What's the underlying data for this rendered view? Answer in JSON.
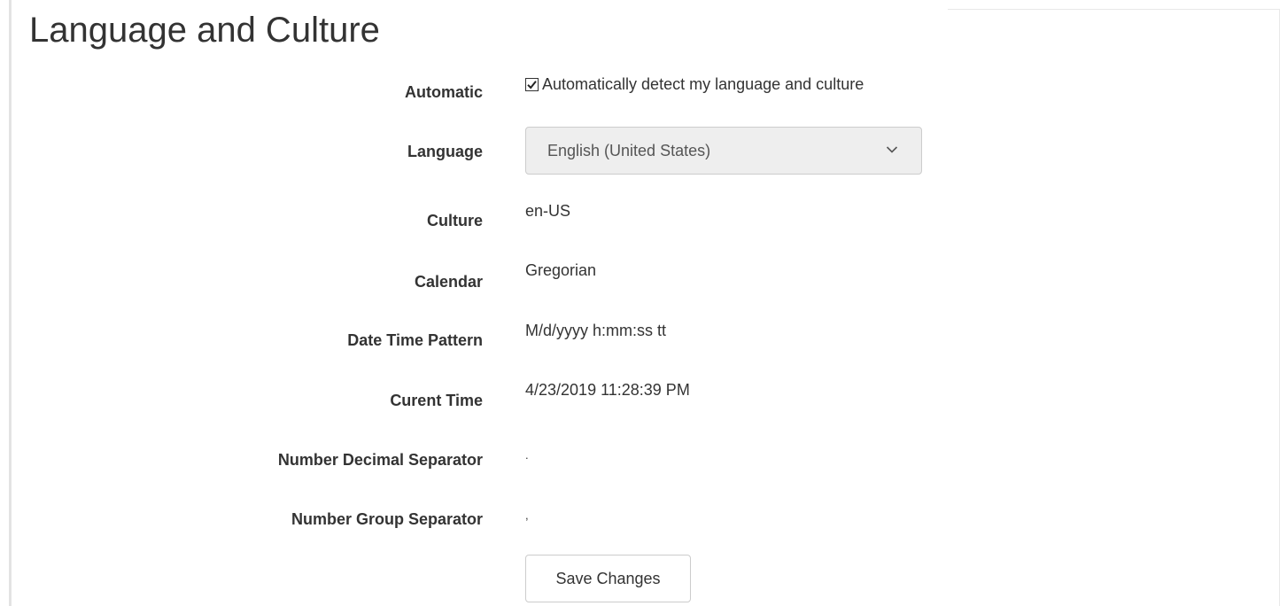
{
  "page": {
    "title": "Language and Culture"
  },
  "form": {
    "automatic": {
      "label": "Automatic",
      "checkbox_label": "Automatically detect my language and culture",
      "checked": true
    },
    "language": {
      "label": "Language",
      "selected": "English (United States)",
      "disabled": true
    },
    "culture": {
      "label": "Culture",
      "value": "en-US"
    },
    "calendar": {
      "label": "Calendar",
      "value": "Gregorian"
    },
    "date_time_pattern": {
      "label": "Date Time Pattern",
      "value": "M/d/yyyy h:mm:ss tt"
    },
    "current_time": {
      "label": "Curent Time",
      "value": "4/23/2019 11:28:39 PM"
    },
    "number_decimal_separator": {
      "label": "Number Decimal Separator",
      "value": "."
    },
    "number_group_separator": {
      "label": "Number Group Separator",
      "value": ","
    },
    "save_label": "Save Changes"
  },
  "icons": {
    "checkbox": "checkmark-icon",
    "dropdown": "chevron-down-icon"
  },
  "colors": {
    "text": "#333333",
    "select_background": "#eeeeee",
    "border": "#cccccc"
  }
}
